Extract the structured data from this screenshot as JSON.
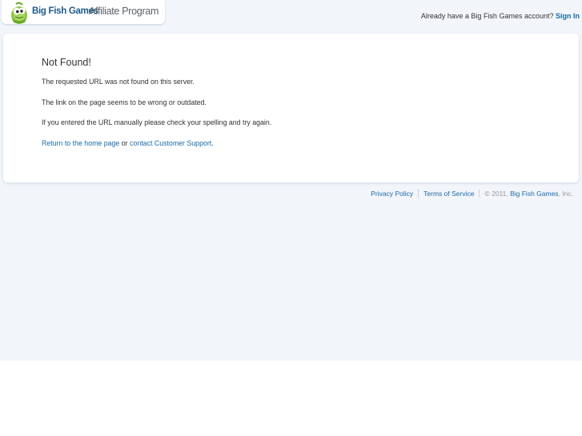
{
  "header": {
    "logo_brand": "Big Fish Games",
    "logo_program": "Affiliate Program",
    "account_prompt": "Already have a Big Fish Games account?",
    "sign_in": "Sign In"
  },
  "main": {
    "title": "Not Found!",
    "line1": "The requested URL was not found on this server.",
    "line2": "The link on the page seems to be wrong or outdated.",
    "line3": "If you entered the URL manually please check your spelling and try again.",
    "home_link": "Return to the home page",
    "or_text": " or ",
    "support_link": "contact Customer Support",
    "period": "."
  },
  "footer": {
    "privacy": "Privacy Policy",
    "terms": "Terms of Service",
    "copyright_prefix": "© 2011, ",
    "company": "Big Fish Games",
    "copyright_suffix": ", Inc."
  },
  "colors": {
    "page_background": "#f2f5fa",
    "link": "#1a6aa8",
    "logo_brand": "#1e5a8c",
    "fish_green": "#8cc63f"
  },
  "icons": {
    "logo": "big-fish-logo-icon"
  }
}
